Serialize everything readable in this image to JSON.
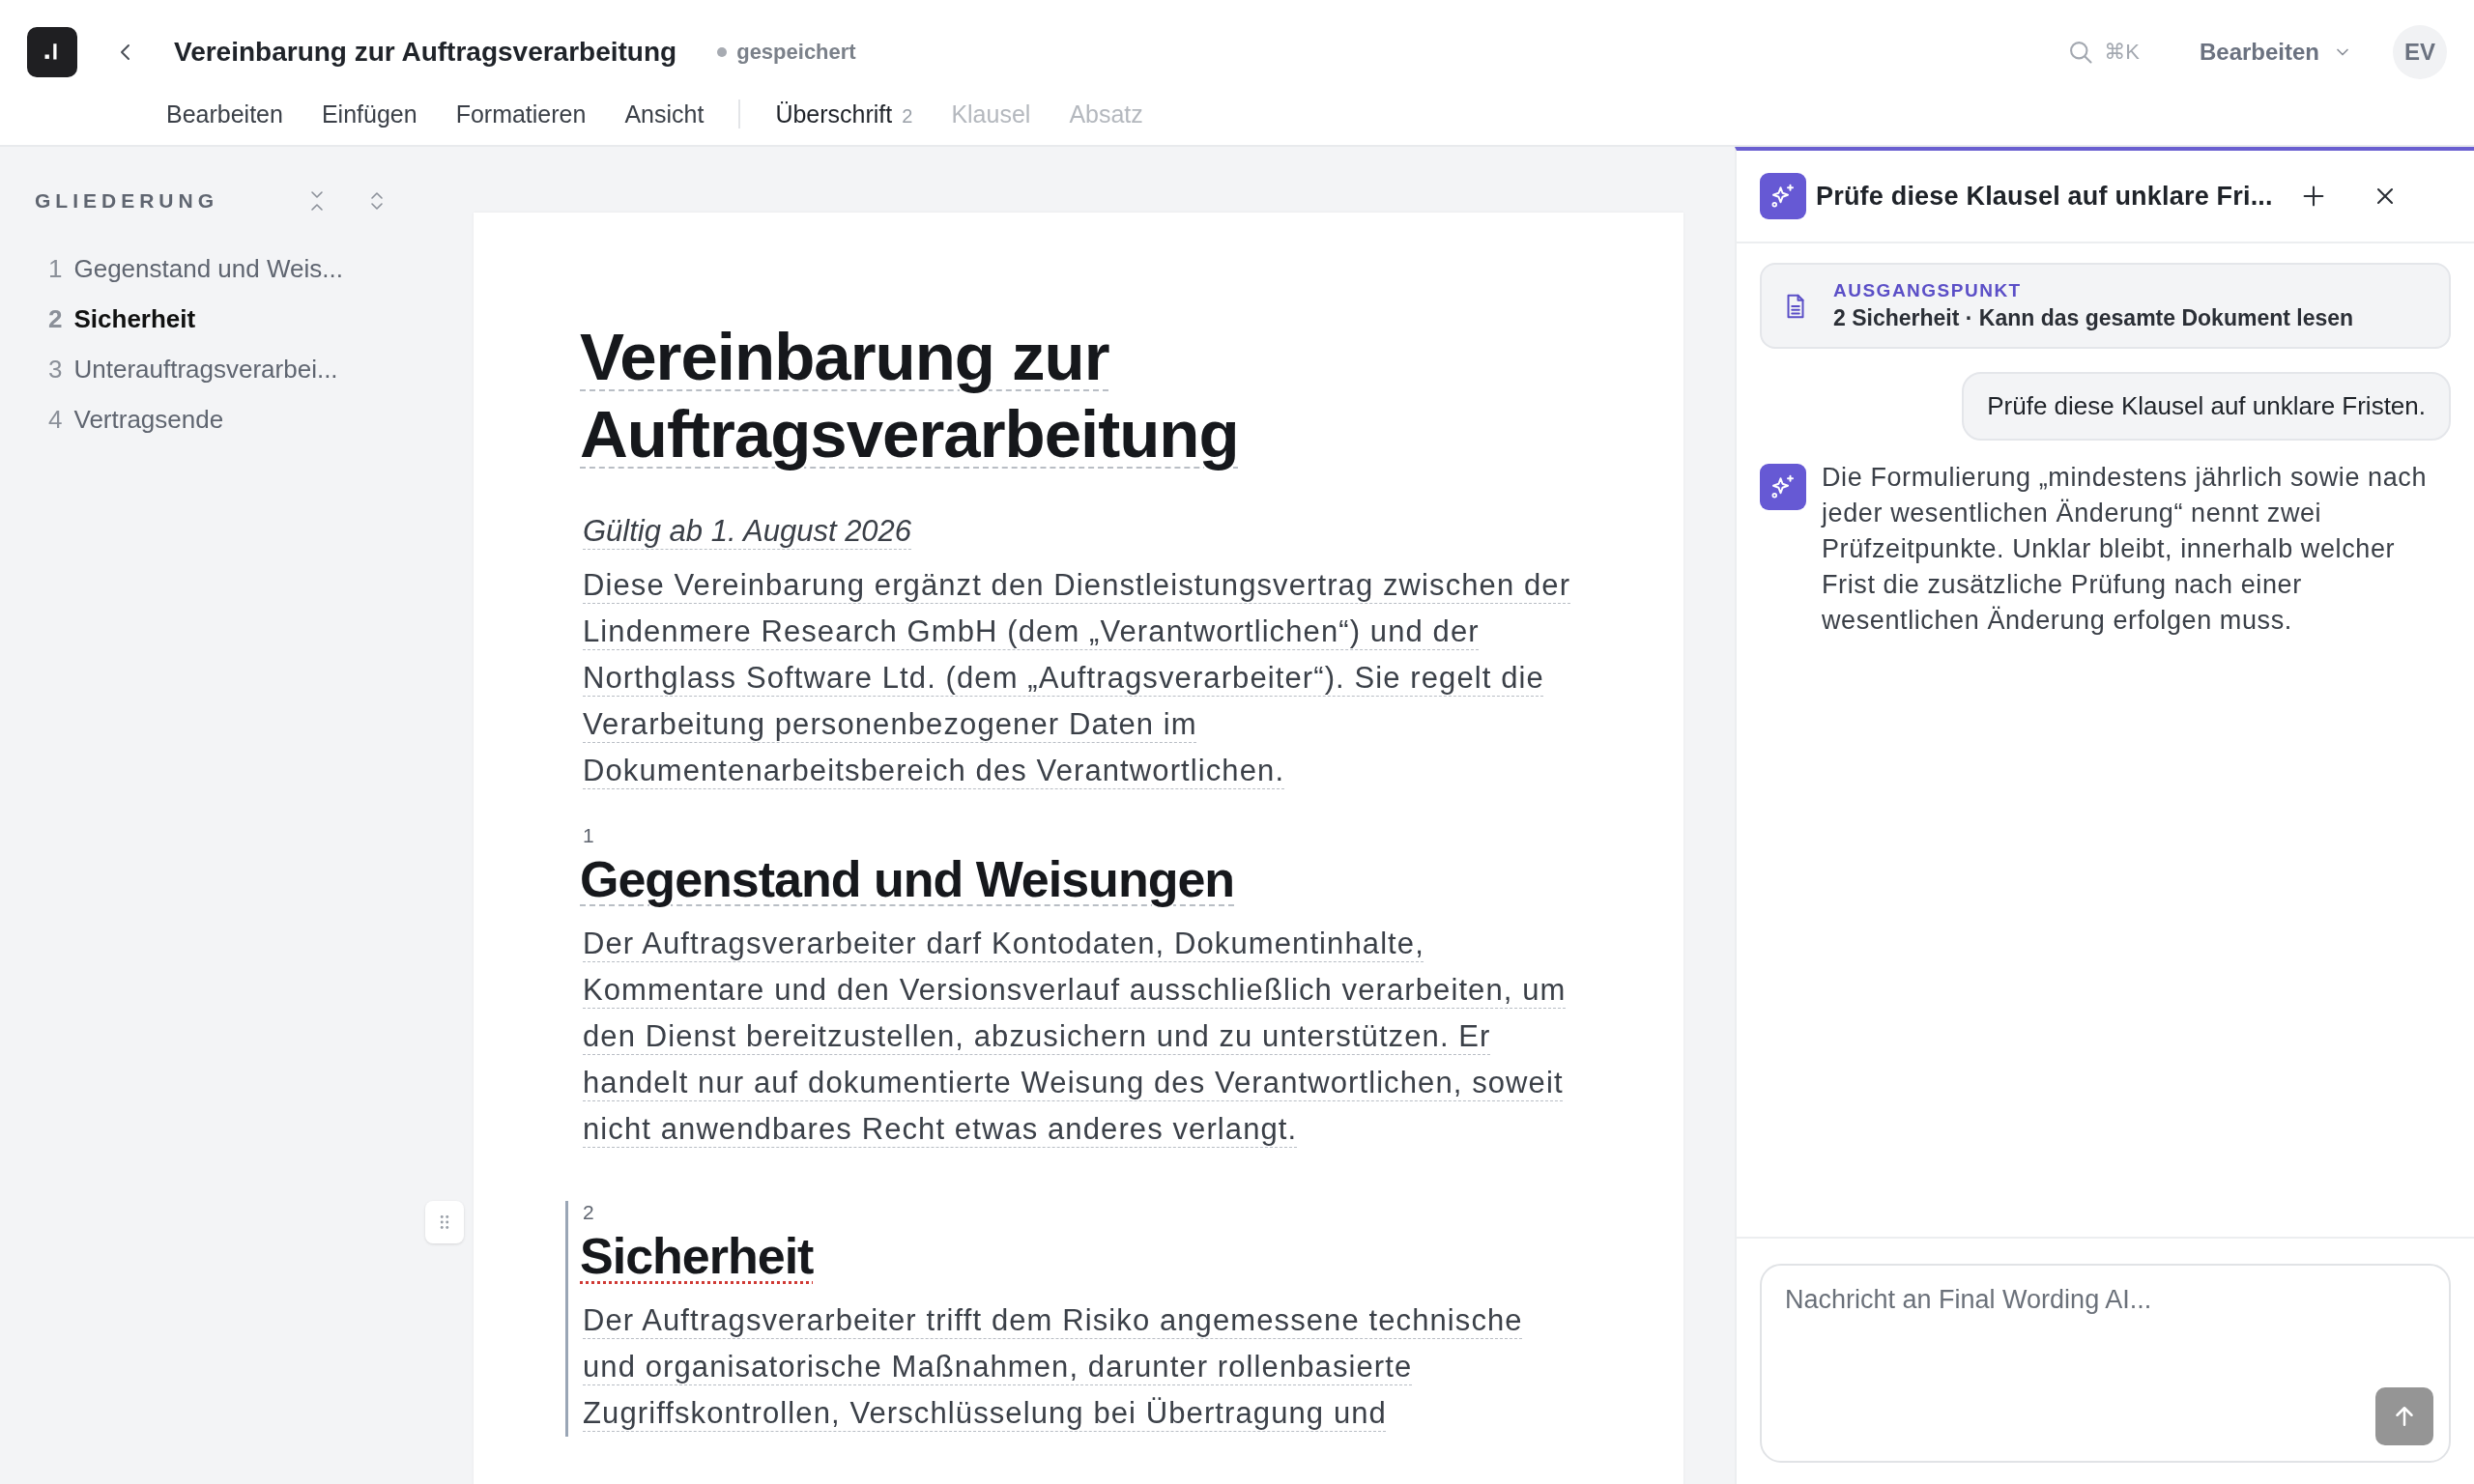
{
  "app": {
    "title": "Vereinbarung zur Auftragsverarbeitung",
    "save_status": "gespeichert",
    "search_shortcut": "⌘K",
    "mode": "Bearbeiten",
    "avatar": "EV"
  },
  "menu": [
    {
      "label": "Bearbeiten"
    },
    {
      "label": "Einfügen"
    },
    {
      "label": "Formatieren"
    },
    {
      "label": "Ansicht"
    }
  ],
  "context_menu": [
    {
      "label": "Überschrift",
      "count": "2",
      "disabled": false
    },
    {
      "label": "Klausel",
      "disabled": true
    },
    {
      "label": "Absatz",
      "disabled": true
    }
  ],
  "outline": {
    "title": "GLIEDERUNG",
    "items": [
      {
        "number": "1",
        "label": "Gegenstand und Weis...",
        "selected": false
      },
      {
        "number": "2",
        "label": "Sicherheit",
        "selected": true
      },
      {
        "number": "3",
        "label": "Unterauftragsverarbei...",
        "selected": false
      },
      {
        "number": "4",
        "label": "Vertragsende",
        "selected": false
      }
    ]
  },
  "document": {
    "title": "Vereinbarung zur Auftragsverarbeitung",
    "effective": "Gültig ab 1. August 2026",
    "intro": "Diese Vereinbarung ergänzt den Dienstleistungsvertrag zwischen der Lindenmere Research GmbH (dem „Verantwortlichen“) und der Northglass Software Ltd. (dem „Auftragsverarbeiter“). Sie regelt die Verarbeitung personenbezogener Daten im Dokumentenarbeitsbereich des Verantwortlichen.",
    "sections": [
      {
        "number": "1",
        "heading": "Gegenstand und Weisungen",
        "selected": false,
        "body": "Der Auftragsverarbeiter darf Kontodaten, Dokumentinhalte, Kommentare und den Versionsverlauf ausschließlich verarbeiten, um den Dienst bereitzustellen, abzusichern und zu unterstützen. Er handelt nur auf dokumentierte Weisung des Verantwortlichen, soweit nicht anwendbares Recht etwas anderes verlangt."
      },
      {
        "number": "2",
        "heading": "Sicherheit",
        "selected": true,
        "body": "Der Auftragsverarbeiter trifft dem Risiko angemessene technische und organisatorische Maßnahmen, darunter rollenbasierte Zugriffskontrollen, Verschlüsselung bei Übertragung und"
      }
    ]
  },
  "assistant": {
    "title": "Prüfe diese Klausel auf unklare Fri...",
    "context": {
      "label": "AUSGANGSPUNKT",
      "text": "2 Sicherheit · Kann das gesamte Dokument lesen"
    },
    "messages": [
      {
        "kind": "user",
        "text": "Prüfe diese Klausel auf unklare Fristen."
      },
      {
        "kind": "reply",
        "text": "Die Formulierung „mindestens jährlich sowie nach jeder wesentlichen Änderung“ nennt zwei Prüfzeitpunkte. Unklar bleibt, innerhalb welcher Frist die zusätzliche Prüfung nach einer wesentlichen Änderung erfolgen muss."
      }
    ],
    "composer": {
      "placeholder": "Nachricht an Final Wording AI...",
      "send_disabled": true
    }
  }
}
